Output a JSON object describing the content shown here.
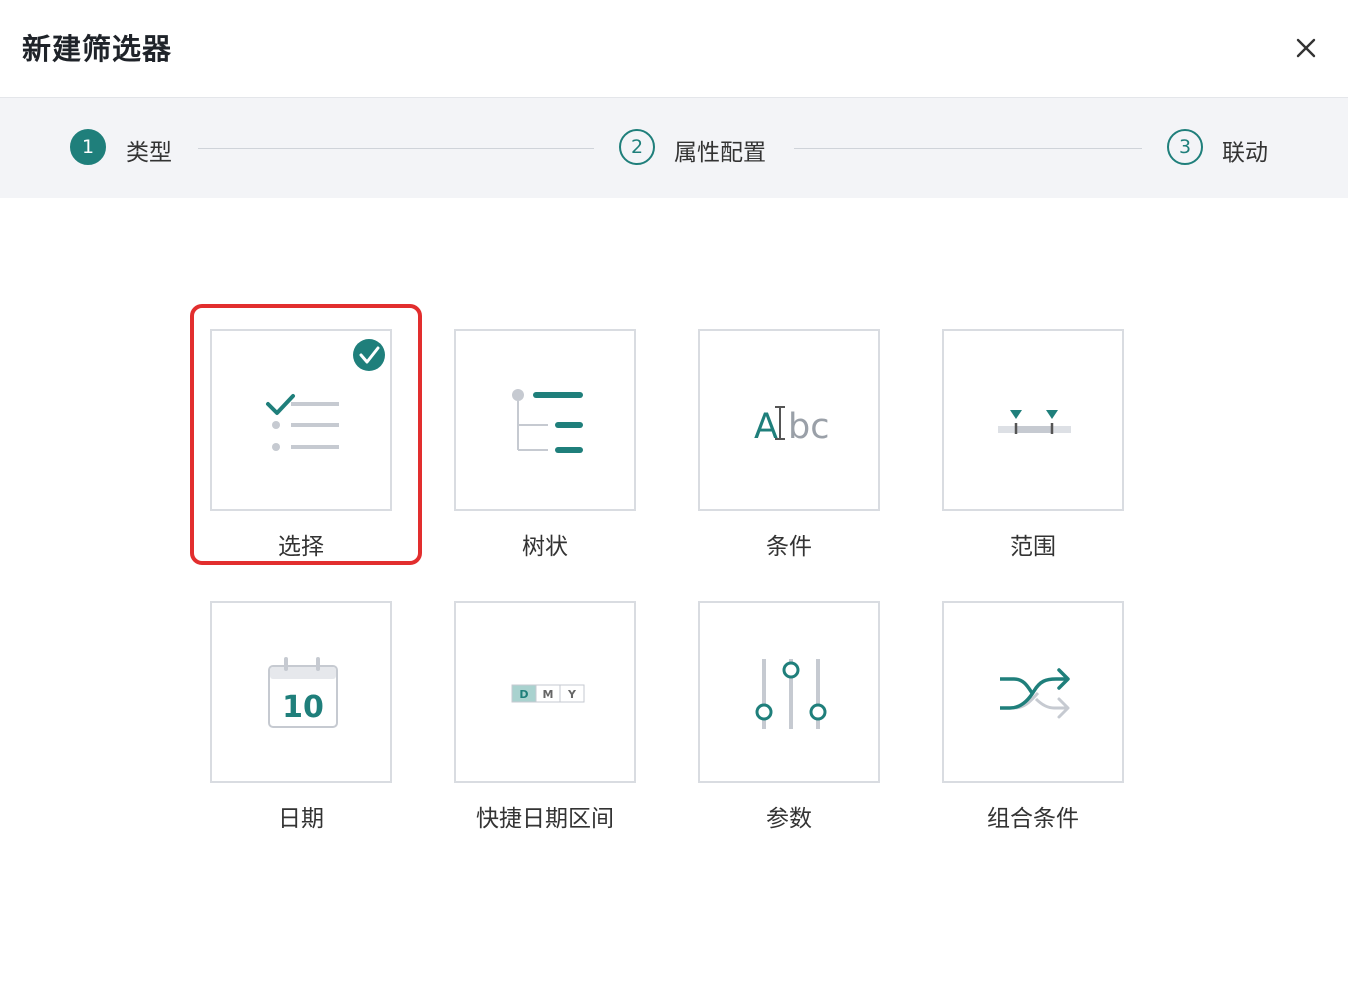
{
  "dialog": {
    "title": "新建筛选器"
  },
  "steps": [
    {
      "number": "1",
      "label": "类型",
      "state": "active"
    },
    {
      "number": "2",
      "label": "属性配置",
      "state": "todo"
    },
    {
      "number": "3",
      "label": "联动",
      "state": "todo"
    }
  ],
  "filter_types": [
    {
      "label": "选择",
      "icon": "checklist-icon",
      "selected": true
    },
    {
      "label": "树状",
      "icon": "tree-icon",
      "selected": false
    },
    {
      "label": "条件",
      "icon": "text-condition-icon",
      "icon_text": [
        "A",
        "bc"
      ],
      "selected": false
    },
    {
      "label": "范围",
      "icon": "range-slider-icon",
      "selected": false
    },
    {
      "label": "日期",
      "icon": "calendar-icon",
      "icon_text": "10",
      "selected": false
    },
    {
      "label": "快捷日期区间",
      "icon": "dmy-toggle-icon",
      "icon_text": [
        "D",
        "M",
        "Y"
      ],
      "selected": false
    },
    {
      "label": "参数",
      "icon": "sliders-icon",
      "selected": false
    },
    {
      "label": "组合条件",
      "icon": "shuffle-icon",
      "selected": false
    }
  ],
  "colors": {
    "accent": "#1f7f7b",
    "highlight": "#e22e2e",
    "border": "#d9dce1",
    "muted": "#c6cad1"
  }
}
